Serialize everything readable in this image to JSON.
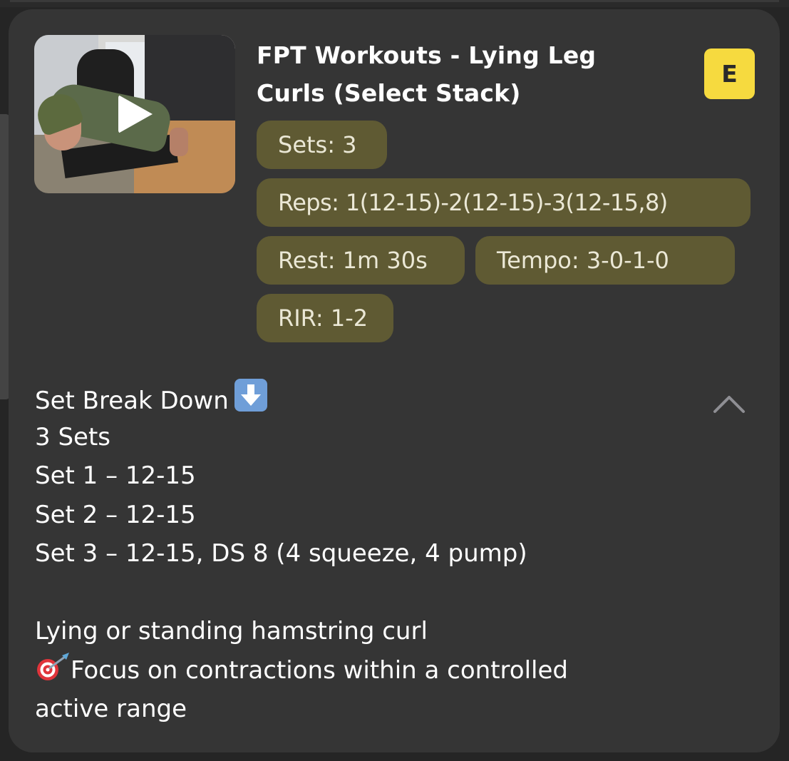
{
  "card": {
    "title": "FPT Workouts - Lying Leg Curls (Select Stack)",
    "difficulty_badge": "E",
    "video": {
      "icon": "play-icon"
    },
    "chips": {
      "sets": "Sets: 3",
      "reps": "Reps: 1(12-15)-2(12-15)-3(12-15,8)",
      "rest": "Rest: 1m 30s",
      "tempo": "Tempo: 3-0-1-0",
      "rir": "RIR: 1-2"
    },
    "collapse_icon": "chevron-up-icon",
    "description": {
      "heading": "Set Break Down",
      "heading_icon": "down-arrow-emoji-icon",
      "lines": [
        "3 Sets",
        "Set 1 – 12-15",
        "Set 2 – 12-15",
        "Set 3 – 12-15, DS 8 (4 squeeze, 4 pump)"
      ],
      "exercise_line": "Lying or standing hamstring curl",
      "focus_icon": "target-dart-emoji-icon",
      "focus_text_line1": "Focus on contractions within a controlled",
      "focus_text_line2": "active range"
    }
  },
  "colors": {
    "background": "#252525",
    "card": "#353535",
    "chip": "#5f5a33",
    "chip_text": "#ebe8d6",
    "badge": "#f6da3f"
  }
}
